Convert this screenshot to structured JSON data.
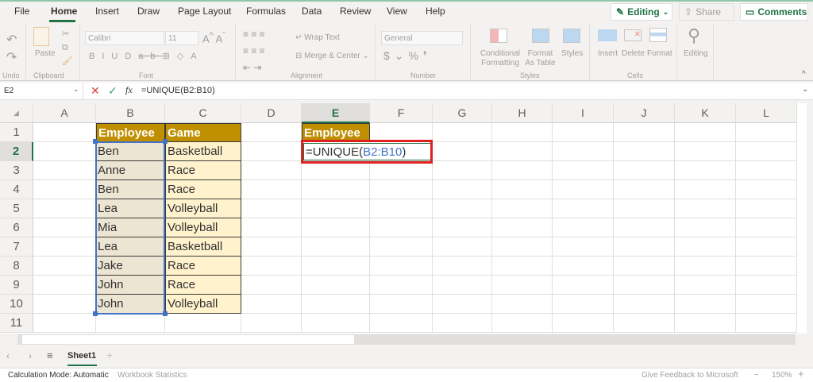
{
  "menu": {
    "tabs": [
      "File",
      "Home",
      "Insert",
      "Draw",
      "Page Layout",
      "Formulas",
      "Data",
      "Review",
      "View",
      "Help"
    ],
    "active": "Home"
  },
  "top_buttons": {
    "editing": "Editing",
    "share": "Share",
    "comments": "Comments"
  },
  "ribbon": {
    "undo_group": "Undo",
    "clipboard_group": "Clipboard",
    "paste": "Paste",
    "font_name": "Calibri",
    "font_size": "11",
    "font_group": "Font",
    "wrap_text": "Wrap Text",
    "merge_center": "Merge & Center",
    "alignment_group": "Alignment",
    "number_format": "General",
    "number_group": "Number",
    "conditional_formatting": "Conditional Formatting",
    "format_as_table": "Format As Table",
    "styles": "Styles",
    "styles_group": "Styles",
    "insert": "Insert",
    "delete": "Delete",
    "format": "Format",
    "cells_group": "Cells",
    "editing": "Editing"
  },
  "formula_bar": {
    "name_box": "E2",
    "formula": "=UNIQUE(B2:B10)"
  },
  "grid": {
    "columns": [
      "A",
      "B",
      "C",
      "D",
      "E",
      "F",
      "G",
      "H",
      "I",
      "J",
      "K",
      "L"
    ],
    "rows": [
      "1",
      "2",
      "3",
      "4",
      "5",
      "6",
      "7",
      "8",
      "9",
      "10",
      "11"
    ],
    "active_cell": "E2",
    "headers": {
      "B1": "Employee",
      "C1": "Game",
      "E1": "Employee"
    },
    "employees": [
      "Ben",
      "Anne",
      "Ben",
      "Lea",
      "Mia",
      "Lea",
      "Jake",
      "John",
      "John"
    ],
    "games": [
      "Basketball",
      "Race",
      "Race",
      "Volleyball",
      "Volleyball",
      "Basketball",
      "Race",
      "Race",
      "Volleyball"
    ],
    "editing_cell": {
      "prefix": "=UNIQUE(",
      "ref": "B2:B10",
      "suffix": ")"
    }
  },
  "colors": {
    "header_fill": "#BF8F00",
    "employee_fill": "#EDE5D3",
    "game_fill": "#FFF2CC",
    "range_highlight": "#4472C4",
    "callout_border": "#E02020",
    "accent": "#217346"
  },
  "sheets": {
    "tabs": [
      "Sheet1"
    ],
    "active": "Sheet1"
  },
  "status": {
    "calc_mode": "Calculation Mode: Automatic",
    "workbook_stats": "Workbook Statistics",
    "feedback": "Give Feedback to Microsoft",
    "zoom": "150%"
  }
}
